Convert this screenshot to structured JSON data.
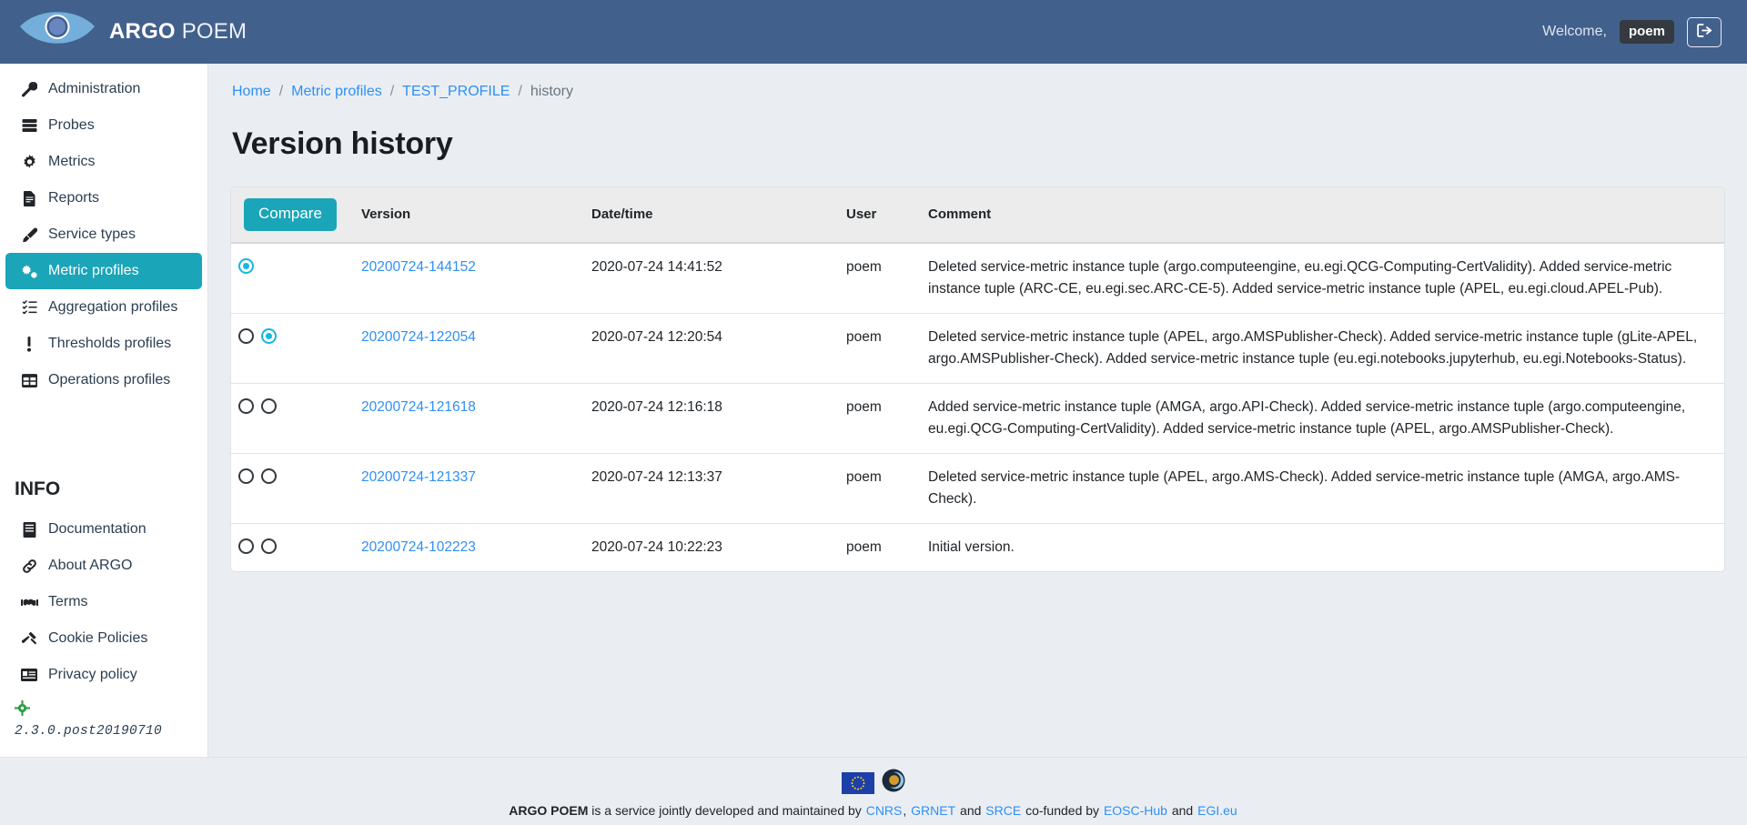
{
  "header": {
    "brand_bold": "ARGO",
    "brand_light": "POEM",
    "welcome_label": "Welcome,",
    "username": "poem",
    "logout_icon": "sign-out-icon",
    "bg_color": "#42608c",
    "badge_color": "#343a40"
  },
  "sidebar": {
    "items": [
      {
        "label": "Administration",
        "icon": "wrench-icon",
        "active": false
      },
      {
        "label": "Probes",
        "icon": "server-icon",
        "active": false
      },
      {
        "label": "Metrics",
        "icon": "cog-icon",
        "active": false
      },
      {
        "label": "Reports",
        "icon": "file-text-icon",
        "active": false
      },
      {
        "label": "Service types",
        "icon": "highlighter-icon",
        "active": false
      },
      {
        "label": "Metric profiles",
        "icon": "cogs-icon",
        "active": true
      },
      {
        "label": "Aggregation profiles",
        "icon": "tasks-list-icon",
        "active": false
      },
      {
        "label": "Thresholds profiles",
        "icon": "exclamation-icon",
        "active": false
      },
      {
        "label": "Operations profiles",
        "icon": "table-icon",
        "active": false
      }
    ],
    "info_heading": "INFO",
    "info_items": [
      {
        "label": "Documentation",
        "icon": "book-icon"
      },
      {
        "label": "About ARGO",
        "icon": "link-icon"
      },
      {
        "label": "Terms",
        "icon": "handshake-icon"
      },
      {
        "label": "Cookie Policies",
        "icon": "gavel-icon"
      },
      {
        "label": "Privacy policy",
        "icon": "id-card-icon"
      }
    ],
    "version_icon": "crosshairs-icon",
    "version_icon_color": "#2f9e44",
    "version": "2.3.0.post20190710",
    "active_color": "#1aa5b8"
  },
  "breadcrumb": {
    "items": [
      {
        "label": "Home",
        "link": true
      },
      {
        "label": "Metric profiles",
        "link": true
      },
      {
        "label": "TEST_PROFILE",
        "link": true
      },
      {
        "label": "history",
        "link": false
      }
    ],
    "separator": "/"
  },
  "main": {
    "page_title": "Version history",
    "compare_button": "Compare",
    "columns": {
      "compare": "",
      "version": "Version",
      "datetime": "Date/time",
      "user": "User",
      "comment": "Comment"
    },
    "rows": [
      {
        "radios": [
          {
            "checked": true,
            "visible": true
          },
          {
            "checked": false,
            "visible": false
          }
        ],
        "version": "20200724-144152",
        "datetime": "2020-07-24 14:41:52",
        "user": "poem",
        "comment": "Deleted service-metric instance tuple (argo.computeengine, eu.egi.QCG-Computing-CertValidity). Added service-metric instance tuple (ARC-CE, eu.egi.sec.ARC-CE-5). Added service-metric instance tuple (APEL, eu.egi.cloud.APEL-Pub)."
      },
      {
        "radios": [
          {
            "checked": false,
            "visible": true
          },
          {
            "checked": true,
            "visible": true
          }
        ],
        "version": "20200724-122054",
        "datetime": "2020-07-24 12:20:54",
        "user": "poem",
        "comment": "Deleted service-metric instance tuple (APEL, argo.AMSPublisher-Check). Added service-metric instance tuple (gLite-APEL, argo.AMSPublisher-Check). Added service-metric instance tuple (eu.egi.notebooks.jupyterhub, eu.egi.Notebooks-Status)."
      },
      {
        "radios": [
          {
            "checked": false,
            "visible": true
          },
          {
            "checked": false,
            "visible": true
          }
        ],
        "version": "20200724-121618",
        "datetime": "2020-07-24 12:16:18",
        "user": "poem",
        "comment": "Added service-metric instance tuple (AMGA, argo.API-Check). Added service-metric instance tuple (argo.computeengine, eu.egi.QCG-Computing-CertValidity). Added service-metric instance tuple (APEL, argo.AMSPublisher-Check)."
      },
      {
        "radios": [
          {
            "checked": false,
            "visible": true
          },
          {
            "checked": false,
            "visible": true
          }
        ],
        "version": "20200724-121337",
        "datetime": "2020-07-24 12:13:37",
        "user": "poem",
        "comment": "Deleted service-metric instance tuple (APEL, argo.AMS-Check). Added service-metric instance tuple (AMGA, argo.AMS-Check)."
      },
      {
        "radios": [
          {
            "checked": false,
            "visible": true
          },
          {
            "checked": false,
            "visible": true
          }
        ],
        "version": "20200724-102223",
        "datetime": "2020-07-24 10:22:23",
        "user": "poem",
        "comment": "Initial version."
      }
    ]
  },
  "footer": {
    "logos": [
      "eu-flag-icon",
      "eosc-hub-logo"
    ],
    "brand": "ARGO POEM",
    "text_1": " is a service jointly developed and maintained by ",
    "link_cnrs": "CNRS",
    "sep_comma": ",",
    "link_grnet": "GRNET",
    "text_and_1": " and ",
    "link_srce": "SRCE",
    "text_2": " co-funded by ",
    "link_eosc": "EOSC-Hub",
    "text_and_2": " and ",
    "link_egi": "EGI.eu"
  }
}
